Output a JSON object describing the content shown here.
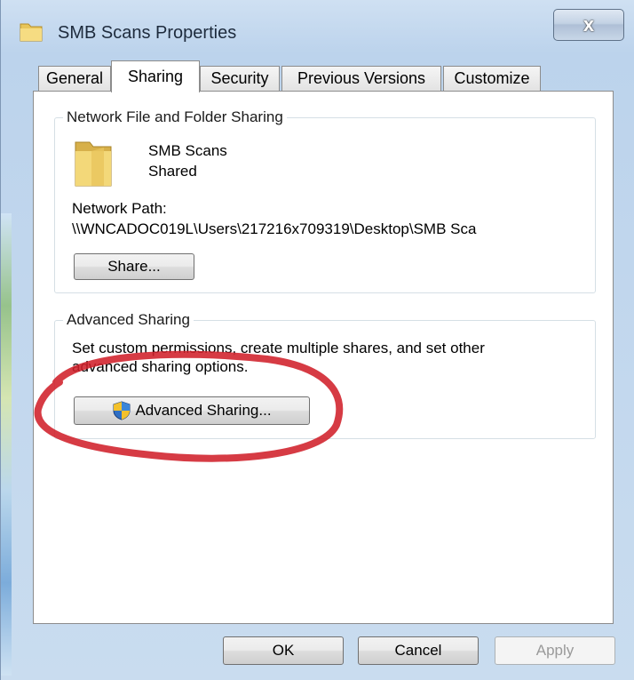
{
  "window": {
    "title": "SMB Scans Properties",
    "close_label": "x"
  },
  "tabs": [
    {
      "label": "General",
      "active": false
    },
    {
      "label": "Sharing",
      "active": true
    },
    {
      "label": "Security",
      "active": false
    },
    {
      "label": "Previous Versions",
      "active": false
    },
    {
      "label": "Customize",
      "active": false
    }
  ],
  "network_sharing": {
    "group_label": "Network File and Folder Sharing",
    "folder_name": "SMB Scans",
    "status": "Shared",
    "path_label": "Network Path:",
    "path_value": "\\\\WNCADOC019L\\Users\\217216x709319\\Desktop\\SMB Sca",
    "share_button": "Share..."
  },
  "advanced_sharing": {
    "group_label": "Advanced Sharing",
    "description_line1": "Set custom permissions, create multiple shares, and set other",
    "description_line2": "advanced sharing options.",
    "button_label": "Advanced Sharing..."
  },
  "footer": {
    "ok": "OK",
    "cancel": "Cancel",
    "apply": "Apply"
  },
  "colors": {
    "highlight_ellipse": "#d0202a",
    "window_frame": "#bcd3ec"
  },
  "icons": {
    "title": "folder-icon",
    "folder": "folder-icon",
    "advanced_button": "uac-shield-icon",
    "close": "close-icon"
  }
}
